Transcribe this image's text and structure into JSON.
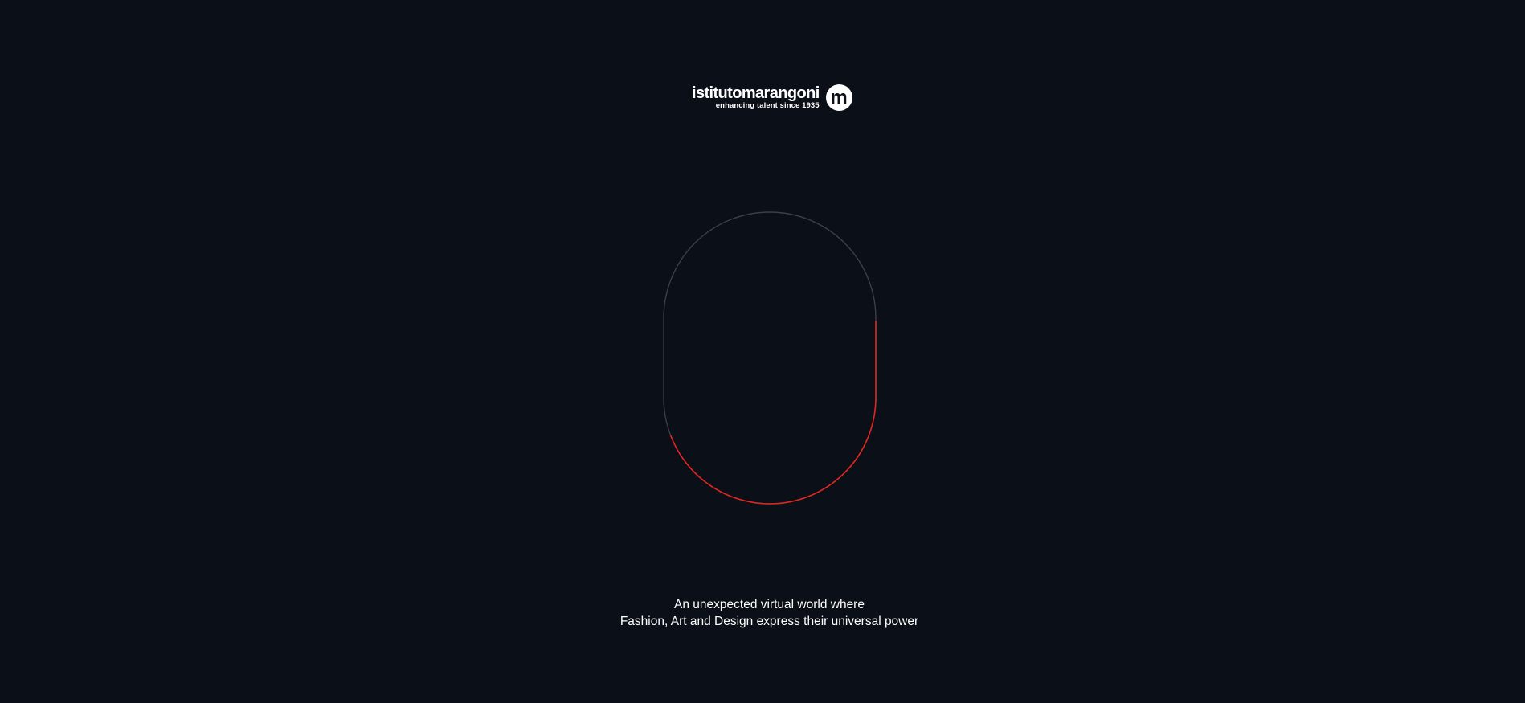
{
  "brand": {
    "name": "istitutomarangoni",
    "tagline": "enhancing talent since 1935",
    "mark_letter": "m",
    "icon": "brand-m-mark"
  },
  "loader": {
    "progress_percent": 45,
    "track_color": "#3a3f48",
    "progress_color": "#e5251e"
  },
  "intro": {
    "line1": "An unexpected virtual world where",
    "line2": "Fashion, Art and Design express their universal power"
  },
  "colors": {
    "background": "#0b0f17",
    "text": "#ffffff"
  }
}
